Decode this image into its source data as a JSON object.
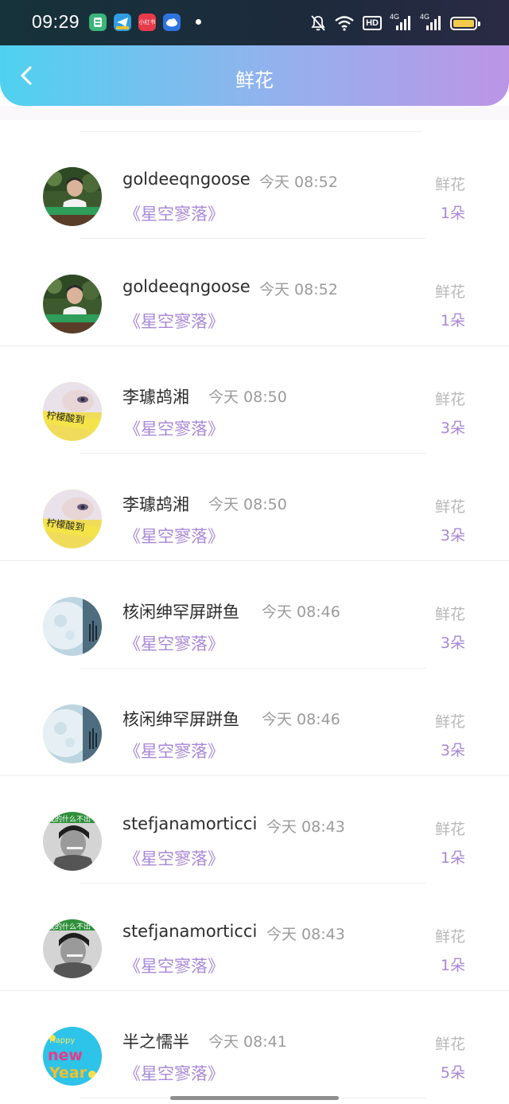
{
  "status_bar": {
    "time": "09:29",
    "apps": [
      {
        "name": "app-green-icon",
        "color": "#3bb57a"
      },
      {
        "name": "app-telegram-icon",
        "color": "#2f9de0"
      },
      {
        "name": "app-xiaohongshu-icon",
        "color": "#e83a4a",
        "label": "小红书"
      },
      {
        "name": "app-blue-cloud-icon",
        "color": "#2f73e0"
      }
    ],
    "hd_label": "HD",
    "network_1": "4G",
    "network_2": "4G",
    "battery_color": "#f2c94c"
  },
  "header": {
    "title": "鲜花",
    "gradient": [
      "#4fd1f0",
      "#bc95e6"
    ]
  },
  "colors": {
    "accent": "#a888d6",
    "muted": "#9b9b9b"
  },
  "list": [
    {
      "username": "goldeeqngoose",
      "time": "今天 08:52",
      "book": "《星空寥落》",
      "gift_label": "鲜花",
      "gift_count": "1朵",
      "avatar": "boy-photo"
    },
    {
      "username": "goldeeqngoose",
      "time": "今天 08:52",
      "book": "《星空寥落》",
      "gift_label": "鲜花",
      "gift_count": "1朵",
      "avatar": "boy-photo"
    },
    {
      "username": "李璩鸪湘",
      "time": "今天 08:50",
      "book": "《星空寥落》",
      "gift_label": "鲜花",
      "gift_count": "3朵",
      "avatar": "girl-yellow"
    },
    {
      "username": "李璩鸪湘",
      "time": "今天 08:50",
      "book": "《星空寥落》",
      "gift_label": "鲜花",
      "gift_count": "3朵",
      "avatar": "girl-yellow"
    },
    {
      "username": "核闲绅罕屏跰鱼",
      "time": "今天 08:46",
      "book": "《星空寥落》",
      "gift_label": "鲜花",
      "gift_count": "3朵",
      "avatar": "moon"
    },
    {
      "username": "核闲绅罕屏跰鱼",
      "time": "今天 08:46",
      "book": "《星空寥落》",
      "gift_label": "鲜花",
      "gift_count": "3朵",
      "avatar": "moon"
    },
    {
      "username": "stefjanamorticci",
      "time": "今天 08:43",
      "book": "《星空寥落》",
      "gift_label": "鲜花",
      "gift_count": "1朵",
      "avatar": "bw-boy"
    },
    {
      "username": "stefjanamorticci",
      "time": "今天 08:43",
      "book": "《星空寥落》",
      "gift_label": "鲜花",
      "gift_count": "1朵",
      "avatar": "bw-boy"
    },
    {
      "username": "半之懦半",
      "time": "今天 08:41",
      "book": "《星空寥落》",
      "gift_label": "鲜花",
      "gift_count": "5朵",
      "avatar": "new-year"
    }
  ]
}
